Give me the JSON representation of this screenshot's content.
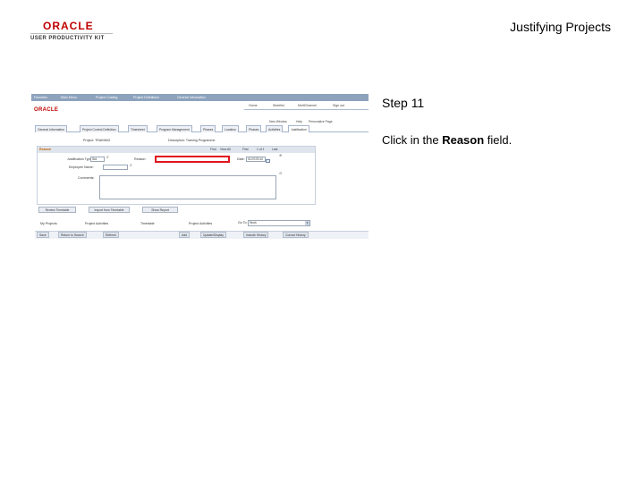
{
  "branding": {
    "oracle_text": "ORACLE",
    "upk_text": "USER PRODUCTIVITY KIT",
    "accent_color": "#c00000"
  },
  "document": {
    "title": "Justifying Projects",
    "step_label": "Step 11",
    "instruction_prefix": "Click in the ",
    "instruction_bold": "Reason",
    "instruction_suffix": " field."
  },
  "screenshot": {
    "nav_items": [
      "Favorites",
      "Main Menu",
      "Project Costing",
      "Project Definitions",
      "General Information"
    ],
    "oracle_text": "ORACLE",
    "top_links": [
      "Home",
      "Worklist",
      "MultiChannel",
      "Sign out"
    ],
    "utility_links": [
      "New Window",
      "Help",
      "Personalize Page"
    ],
    "tabs": [
      "General Information",
      "Project Control Definition",
      "Timesheet",
      "Program Management",
      "Phases",
      "Location",
      "Phases",
      "Activities",
      "Justification"
    ],
    "active_tab_index": 8,
    "header": {
      "project_label": "Project: TRAINING",
      "description": "Description: Training Programme"
    },
    "panel": {
      "title": "Reason",
      "nav": [
        "Find",
        "View All",
        "First",
        "1 of 1",
        "Last"
      ],
      "justification_label": "Justification Type:",
      "justification_value": "Std",
      "reason_label": "Reason:",
      "employee_label": "Employee Name:",
      "date_label": "Date:",
      "date_value": "01/07/2010",
      "comments_label": "Comments:"
    },
    "buttons": [
      "Review Timetable",
      "Import from Timetable",
      "Show Report"
    ],
    "links_row": [
      "My Projects",
      "Project Activities",
      "Timetable",
      "Project Activities"
    ],
    "goto_label": "Go To:",
    "goto_value": "Work",
    "footer_buttons": [
      "Save",
      "Return to Search",
      "Refresh",
      "Add",
      "Update/Display",
      "Include History",
      "Correct History"
    ],
    "highlight_color": "#e0141e"
  }
}
